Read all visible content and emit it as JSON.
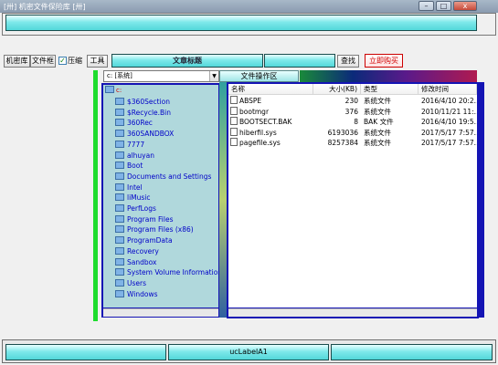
{
  "window": {
    "title": "[卅] 机密文件保险库 [卅]",
    "min_glyph": "–",
    "max_glyph": "□",
    "close_glyph": "x"
  },
  "toolbar": {
    "tab_vault": "机密库",
    "tab_folder": "文件框",
    "compress_checked": true,
    "compress_label": "压缩",
    "tools_label": "工具",
    "article_title_label": "文章标题",
    "search_value": "",
    "search_label": "查找",
    "buy_label": "立即购买"
  },
  "left_panel": {
    "drive_selected": "c: [系统]",
    "tree_root": "c:",
    "folders": [
      "$360Section",
      "$Recycle.Bin",
      "360Rec",
      "360SANDBOX",
      "7777",
      "alhuyan",
      "Boot",
      "Documents and Settings",
      "Intel",
      "liMusic",
      "PerfLogs",
      "Program Files",
      "Program Files (x86)",
      "ProgramData",
      "Recovery",
      "Sandbox",
      "System Volume Information",
      "Users",
      "Windows"
    ]
  },
  "right_panel": {
    "tab_label": "文件操作区",
    "columns": [
      "名称",
      "大小(KB)",
      "类型",
      "修改时间"
    ],
    "files": [
      {
        "name": "ABSPE",
        "size": "230",
        "type": "系统文件",
        "modified": "2016/4/10 20:2..."
      },
      {
        "name": "bootmgr",
        "size": "376",
        "type": "系统文件",
        "modified": "2010/11/21 11:..."
      },
      {
        "name": "BOOTSECT.BAK",
        "size": "8",
        "type": "BAK 文件",
        "modified": "2016/4/10 19:5..."
      },
      {
        "name": "hiberfil.sys",
        "size": "6193036",
        "type": "系统文件",
        "modified": "2017/5/17 7:57..."
      },
      {
        "name": "pagefile.sys",
        "size": "8257384",
        "type": "系统文件",
        "modified": "2017/5/17 7:57..."
      }
    ]
  },
  "status_bar": {
    "left": "",
    "center": "ucLabelA1",
    "right": ""
  },
  "colors": {
    "accent_teal": "#53d7d9",
    "tree_frame_blue": "#1414b4",
    "folder_text": "#0000c8",
    "highlight_red": "#d00000",
    "green_strip": "#1edc2e"
  }
}
